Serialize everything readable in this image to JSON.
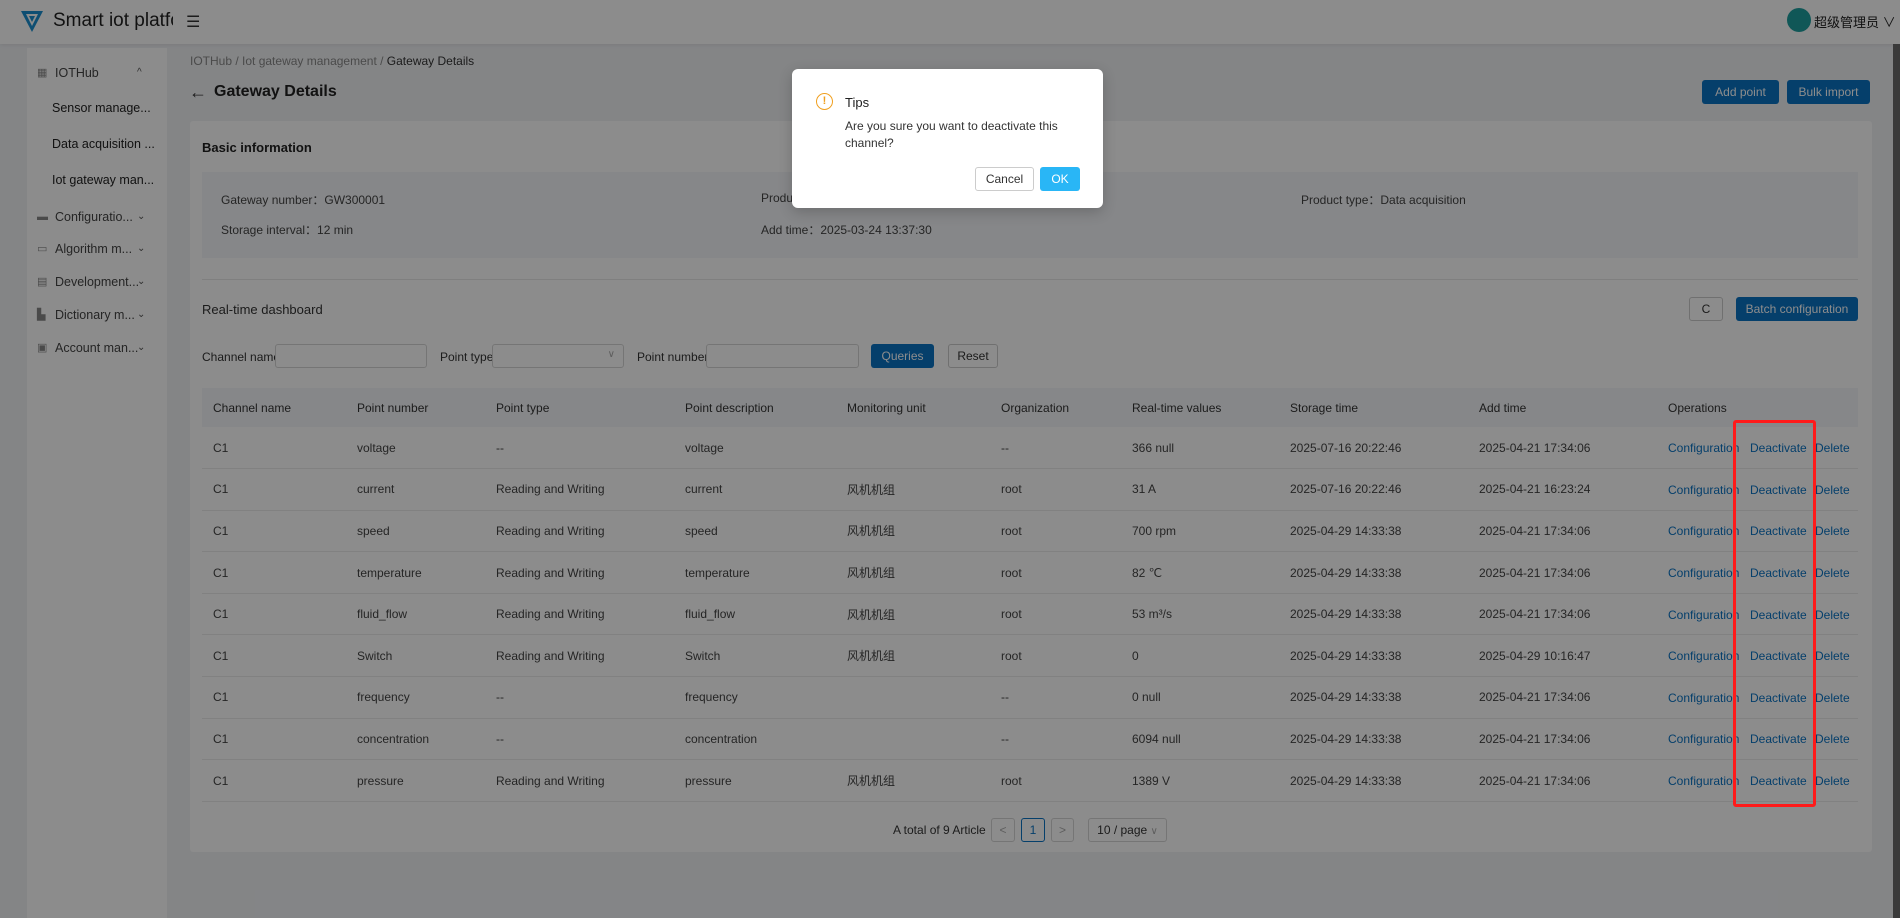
{
  "app": {
    "title": "Smart iot platform",
    "user": "超级管理员"
  },
  "sidebar": {
    "items": [
      {
        "label": "IOTHub",
        "icon": "grid-icon",
        "chevron": "^"
      },
      {
        "label": "Sensor manage..."
      },
      {
        "label": "Data acquisition ..."
      },
      {
        "label": "Iot gateway man..."
      },
      {
        "label": "Configuratio...",
        "icon": "config-icon",
        "chevron": "⌄"
      },
      {
        "label": "Algorithm m...",
        "icon": "algorithm-icon",
        "chevron": "⌄"
      },
      {
        "label": "Development...",
        "icon": "development-icon",
        "chevron": "⌄"
      },
      {
        "label": "Dictionary m...",
        "icon": "dictionary-icon",
        "chevron": "⌄"
      },
      {
        "label": "Account man...",
        "icon": "account-icon",
        "chevron": "⌄"
      }
    ]
  },
  "breadcrumb": [
    "IOTHub",
    "Iot gateway management",
    "Gateway Details"
  ],
  "page": {
    "title": "Gateway Details",
    "add_point": "Add point",
    "bulk_import": "Bulk import"
  },
  "basic": {
    "title": "Basic information",
    "gateway_number": "Gateway number：GW300001",
    "product": "Produ",
    "product_type": "Product type：Data acquisition",
    "storage_interval": "Storage interval：12 min",
    "add_time": "Add time：2025-03-24 13:37:30"
  },
  "dashboard": {
    "title": "Real-time dashboard",
    "refresh": "C",
    "batch": "Batch configuration"
  },
  "filters": {
    "channel_name": "Channel name",
    "point_type": "Point type",
    "point_number": "Point number",
    "queries": "Queries",
    "reset": "Reset"
  },
  "table": {
    "headers": [
      "Channel name",
      "Point number",
      "Point type",
      "Point description",
      "Monitoring unit",
      "Organization",
      "Real-time values",
      "Storage time",
      "Add time",
      "Operations"
    ],
    "ops": [
      "Configuration",
      "Deactivate",
      "Delete"
    ],
    "rows": [
      [
        "C1",
        "voltage",
        "--",
        "voltage",
        "",
        "--",
        "366 null",
        "2025-07-16 20:22:46",
        "2025-04-21 17:34:06"
      ],
      [
        "C1",
        "current",
        "Reading and Writing",
        "current",
        "风机机组",
        "root",
        "31 A",
        "2025-07-16 20:22:46",
        "2025-04-21 16:23:24"
      ],
      [
        "C1",
        "speed",
        "Reading and Writing",
        "speed",
        "风机机组",
        "root",
        "700 rpm",
        "2025-04-29 14:33:38",
        "2025-04-21 17:34:06"
      ],
      [
        "C1",
        "temperature",
        "Reading and Writing",
        "temperature",
        "风机机组",
        "root",
        "82 ℃",
        "2025-04-29 14:33:38",
        "2025-04-21 17:34:06"
      ],
      [
        "C1",
        "fluid_flow",
        "Reading and Writing",
        "fluid_flow",
        "风机机组",
        "root",
        "53 m³/s",
        "2025-04-29 14:33:38",
        "2025-04-21 17:34:06"
      ],
      [
        "C1",
        "Switch",
        "Reading and Writing",
        "Switch",
        "风机机组",
        "root",
        "0",
        "2025-04-29 14:33:38",
        "2025-04-29 10:16:47"
      ],
      [
        "C1",
        "frequency",
        "--",
        "frequency",
        "",
        "--",
        "0 null",
        "2025-04-29 14:33:38",
        "2025-04-21 17:34:06"
      ],
      [
        "C1",
        "concentration",
        "--",
        "concentration",
        "",
        "--",
        "6094 null",
        "2025-04-29 14:33:38",
        "2025-04-21 17:34:06"
      ],
      [
        "C1",
        "pressure",
        "Reading and Writing",
        "pressure",
        "风机机组",
        "root",
        "1389 V",
        "2025-04-29 14:33:38",
        "2025-04-21 17:34:06"
      ]
    ]
  },
  "pagination": {
    "total": "A total of 9 Article",
    "prev": "<",
    "page": "1",
    "next": ">",
    "size": "10 / page"
  },
  "modal": {
    "title": "Tips",
    "message": "Are you sure you want to deactivate this channel?",
    "cancel": "Cancel",
    "ok": "OK"
  },
  "colors": {
    "primary": "#0a73c4",
    "ok": "#29b6f6",
    "warning": "#f0a020",
    "highlight": "#ff1a1a"
  }
}
